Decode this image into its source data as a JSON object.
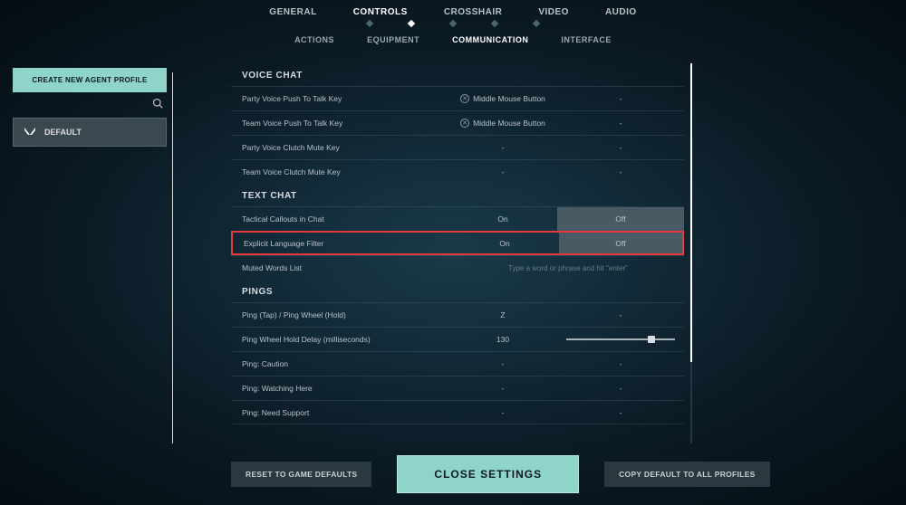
{
  "top_nav": {
    "items": [
      "GENERAL",
      "CONTROLS",
      "CROSSHAIR",
      "VIDEO",
      "AUDIO"
    ],
    "active": "CONTROLS"
  },
  "sub_nav": {
    "items": [
      "ACTIONS",
      "EQUIPMENT",
      "COMMUNICATION",
      "INTERFACE"
    ],
    "active": "COMMUNICATION"
  },
  "sidebar": {
    "create_label": "CREATE NEW AGENT PROFILE",
    "profile_name": "DEFAULT"
  },
  "sections": {
    "voice_chat": {
      "title": "VOICE CHAT",
      "rows": [
        {
          "label": "Party Voice Push To Talk Key",
          "v1": "Middle Mouse Button",
          "v2": "-",
          "x": true
        },
        {
          "label": "Team Voice Push To Talk Key",
          "v1": "Middle Mouse Button",
          "v2": "-",
          "x": true
        },
        {
          "label": "Party Voice Clutch Mute Key",
          "v1": "-",
          "v2": "-"
        },
        {
          "label": "Team Voice Clutch Mute Key",
          "v1": "-",
          "v2": "-"
        }
      ]
    },
    "text_chat": {
      "title": "TEXT CHAT",
      "rows": [
        {
          "label": "Tactical Callouts in Chat",
          "on": "On",
          "off": "Off"
        },
        {
          "label": "Explicit Language Filter",
          "on": "On",
          "off": "Off",
          "highlight": true
        },
        {
          "label": "Muted Words List",
          "placeholder": "Type a word or phrase and hit \"enter\""
        }
      ]
    },
    "pings": {
      "title": "PINGS",
      "rows": [
        {
          "label": "Ping (Tap) / Ping Wheel (Hold)",
          "v1": "Z",
          "v2": "-"
        },
        {
          "label": "Ping Wheel Hold Delay (milliseconds)",
          "v1": "130",
          "slider": true
        },
        {
          "label": "Ping: Caution",
          "v1": "-",
          "v2": "-"
        },
        {
          "label": "Ping: Watching Here",
          "v1": "-",
          "v2": "-"
        },
        {
          "label": "Ping: Need Support",
          "v1": "-",
          "v2": "-"
        }
      ]
    }
  },
  "bottom": {
    "reset": "RESET TO GAME DEFAULTS",
    "close": "CLOSE SETTINGS",
    "copy": "COPY DEFAULT TO ALL PROFILES"
  }
}
